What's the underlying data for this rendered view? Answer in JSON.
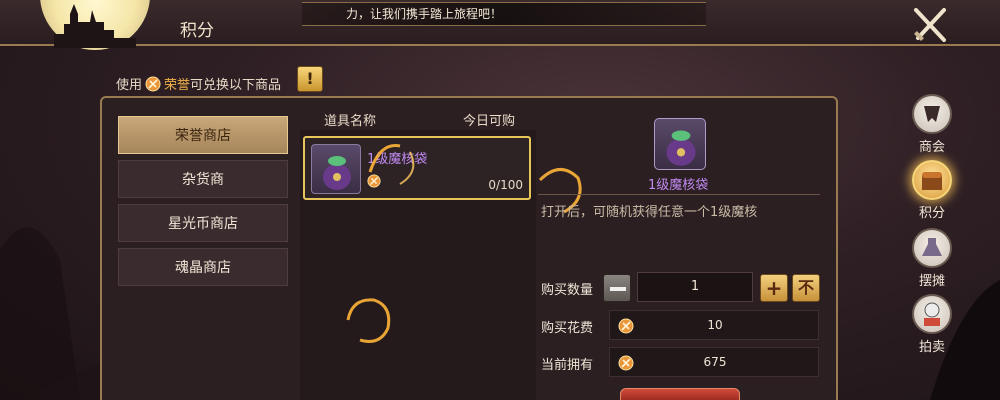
{
  "header": {
    "title": "积分",
    "marquee": "力，让我们携手踏上旅程吧！",
    "close_icon": "close-swords-icon"
  },
  "hint": {
    "prefix": "使用",
    "currency": "荣誉",
    "suffix": "可兑换以下商品",
    "help_label": "!"
  },
  "tabs": [
    {
      "label": "荣誉商店",
      "active": true
    },
    {
      "label": "杂货商",
      "active": false
    },
    {
      "label": "星光币商店",
      "active": false
    },
    {
      "label": "魂晶商店",
      "active": false
    }
  ],
  "columns": {
    "name": "道具名称",
    "today": "今日可购"
  },
  "items": [
    {
      "name": "1级魔核袋",
      "count": "0/100",
      "icon": "magic-core-bag-icon"
    }
  ],
  "detail": {
    "name": "1级魔核袋",
    "description": "打开后，可随机获得任意一个1级魔核",
    "quantity_label": "购买数量",
    "quantity": "1",
    "plus_label": "+",
    "max_label": "不",
    "cost_label": "购买花费",
    "cost": "10",
    "owned_label": "当前拥有",
    "owned": "675"
  },
  "side_nav": [
    {
      "label": "商会",
      "icon": "guild-emblem-icon",
      "active": false
    },
    {
      "label": "积分",
      "icon": "treasure-chest-icon",
      "active": true
    },
    {
      "label": "摆摊",
      "icon": "stall-potion-icon",
      "active": false
    },
    {
      "label": "拍卖",
      "icon": "auction-character-icon",
      "active": false
    }
  ],
  "colors": {
    "accent_gold": "#e6c55a",
    "item_purple": "#c08af0",
    "honor_orange": "#f0b24a"
  }
}
